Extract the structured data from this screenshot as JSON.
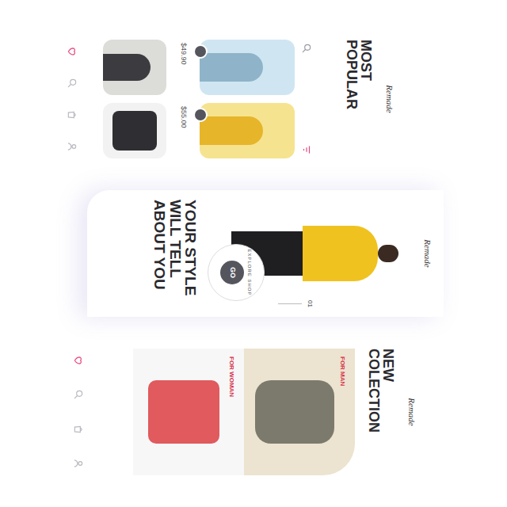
{
  "most_popular": {
    "logo": "Remade",
    "title": "MOST POPULAR",
    "products": [
      {
        "price": "$49.90"
      },
      {
        "price": "$55.00"
      }
    ],
    "nav": [
      {
        "selected": true
      },
      {
        "selected": false
      },
      {
        "selected": false
      },
      {
        "selected": false
      }
    ]
  },
  "hero": {
    "logo": "Remade",
    "title": "YOUR STYLE WILL TELL ABOUT YOU",
    "badge": {
      "ring": "EXPLORE SHOP",
      "button": "GO"
    },
    "slide": "01"
  },
  "new_collection": {
    "logo": "Remade",
    "title": "NEW COLECTION",
    "categories": [
      {
        "label": "FOR MAN"
      },
      {
        "label": "FOR WOMAN"
      }
    ],
    "nav": [
      {
        "selected": true
      },
      {
        "selected": false
      },
      {
        "selected": false
      },
      {
        "selected": false
      }
    ]
  }
}
